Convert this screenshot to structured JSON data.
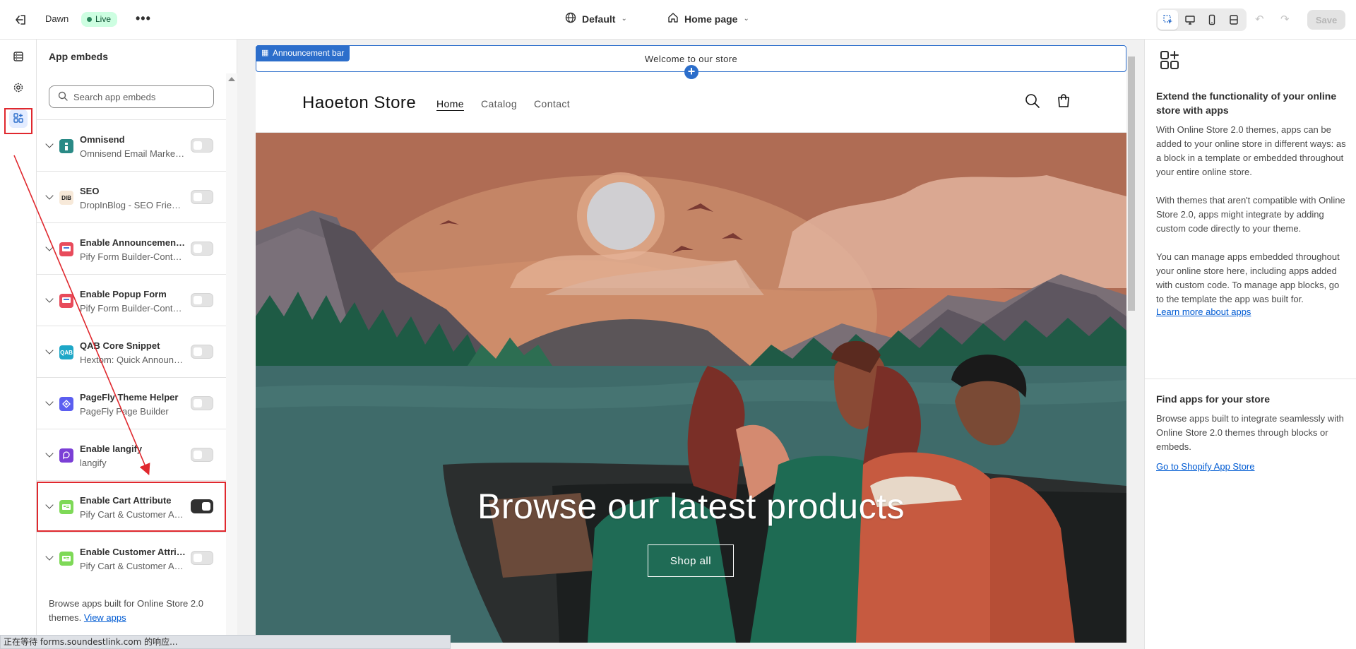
{
  "topbar": {
    "theme_name": "Dawn",
    "live_badge": "Live",
    "more_label": "•••",
    "theme_select": "Default",
    "page_select": "Home page",
    "save_label": "Save"
  },
  "panel": {
    "title": "App embeds",
    "search_placeholder": "Search app embeds",
    "embeds": [
      {
        "name": "Omnisend",
        "sub": "Omnisend Email Marketing & SMS",
        "icon_color": "#2a8a86",
        "icon_text": "",
        "enabled": false
      },
      {
        "name": "SEO",
        "sub": "DropInBlog - SEO Friendly Blog",
        "icon_color": "#f7e9d9",
        "icon_text": "DIB",
        "enabled": false
      },
      {
        "name": "Enable Announcement Bar",
        "sub": "Pify Form Builder-Contact Form",
        "icon_color": "#e84b5b",
        "icon_text": "",
        "enabled": false
      },
      {
        "name": "Enable Popup Form",
        "sub": "Pify Form Builder-Contact Form",
        "icon_color": "#e84b5b",
        "icon_text": "",
        "enabled": false
      },
      {
        "name": "QAB Core Snippet",
        "sub": "Hextom: Quick Announcement Bar",
        "icon_color": "#1ea7c7",
        "icon_text": "QAB",
        "enabled": false
      },
      {
        "name": "PageFly Theme Helper",
        "sub": "PageFly Page Builder",
        "icon_color": "#5b5ef0",
        "icon_text": "",
        "enabled": false
      },
      {
        "name": "Enable langify",
        "sub": "langify",
        "icon_color": "#7b3fd6",
        "icon_text": "",
        "enabled": false
      },
      {
        "name": "Enable Cart Attribute",
        "sub": "Pify Cart & Customer Attributes",
        "icon_color": "#7ed957",
        "icon_text": "",
        "enabled": true
      },
      {
        "name": "Enable Customer Attribute",
        "sub": "Pify Cart & Customer Attributes",
        "icon_color": "#7ed957",
        "icon_text": "",
        "enabled": false
      }
    ],
    "footer_text": "Browse apps built for Online Store 2.0 themes.",
    "footer_link": "View apps"
  },
  "preview": {
    "announcement_tag": "Announcement bar",
    "announcement_text": "Welcome to our store",
    "store_name": "Haoeton Store",
    "nav": [
      "Home",
      "Catalog",
      "Contact"
    ],
    "hero_title": "Browse our latest products",
    "hero_button": "Shop all"
  },
  "info": {
    "heading": "Extend the functionality of your online store with apps",
    "para1": "With Online Store 2.0 themes, apps can be added to your online store in different ways: as a block in a template or embedded throughout your entire online store.",
    "para2": "With themes that aren't compatible with Online Store 2.0, apps might integrate by adding custom code directly to your theme.",
    "para3": "You can manage apps embedded throughout your online store here, including apps added with custom code. To manage app blocks, go to the template the app was built for.",
    "link1": "Learn more about apps",
    "heading2": "Find apps for your store",
    "para4": "Browse apps built to integrate seamlessly with Online Store 2.0 themes through blocks or embeds.",
    "link2": "Go to Shopify App Store"
  },
  "statusbar": {
    "text": "正在等待 forms.soundestlink.com 的响应..."
  },
  "colors": {
    "accent_blue": "#2c6ecb",
    "highlight_red": "#e0282e",
    "live_green": "#cdfee1"
  }
}
